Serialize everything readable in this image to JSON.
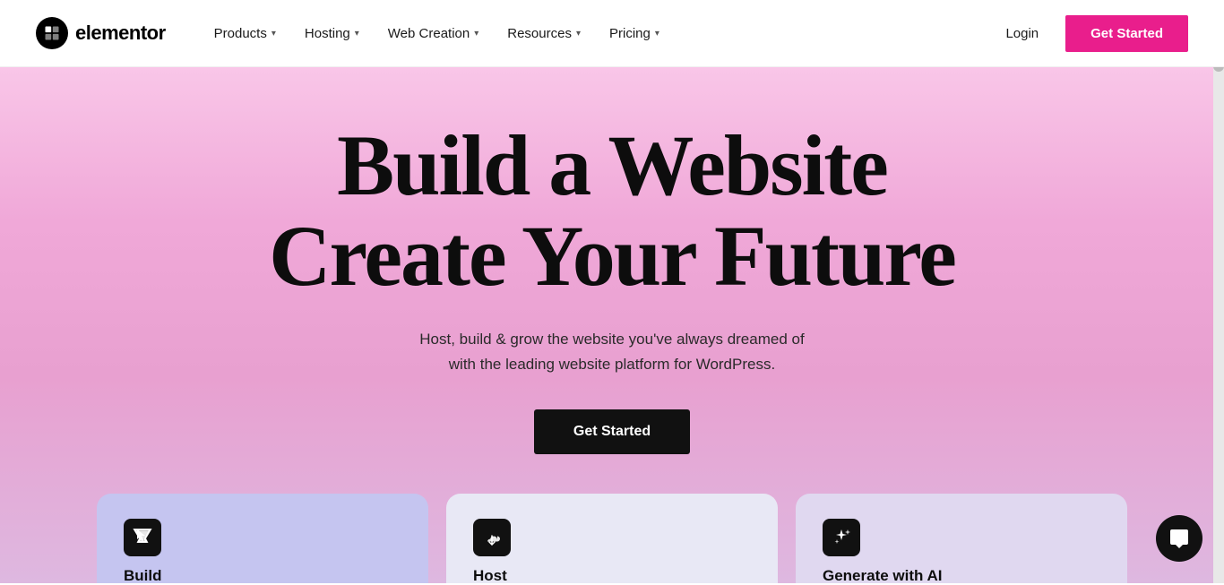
{
  "brand": {
    "name": "elementor",
    "logo_alt": "Elementor Logo"
  },
  "navbar": {
    "products_label": "Products",
    "hosting_label": "Hosting",
    "web_creation_label": "Web Creation",
    "resources_label": "Resources",
    "pricing_label": "Pricing",
    "login_label": "Login",
    "get_started_label": "Get Started"
  },
  "hero": {
    "title_line1": "Build a Website",
    "title_line2": "Create Your Future",
    "subtitle_line1": "Host, build & grow the website you've always dreamed of",
    "subtitle_line2": "with the leading website platform for WordPress.",
    "cta_label": "Get Started"
  },
  "features": [
    {
      "id": "build",
      "icon": "build-icon",
      "label": "Build"
    },
    {
      "id": "host",
      "icon": "host-icon",
      "label": "Host"
    },
    {
      "id": "ai",
      "icon": "ai-icon",
      "label": "Generate with AI"
    }
  ],
  "chat": {
    "icon": "chat-icon"
  }
}
